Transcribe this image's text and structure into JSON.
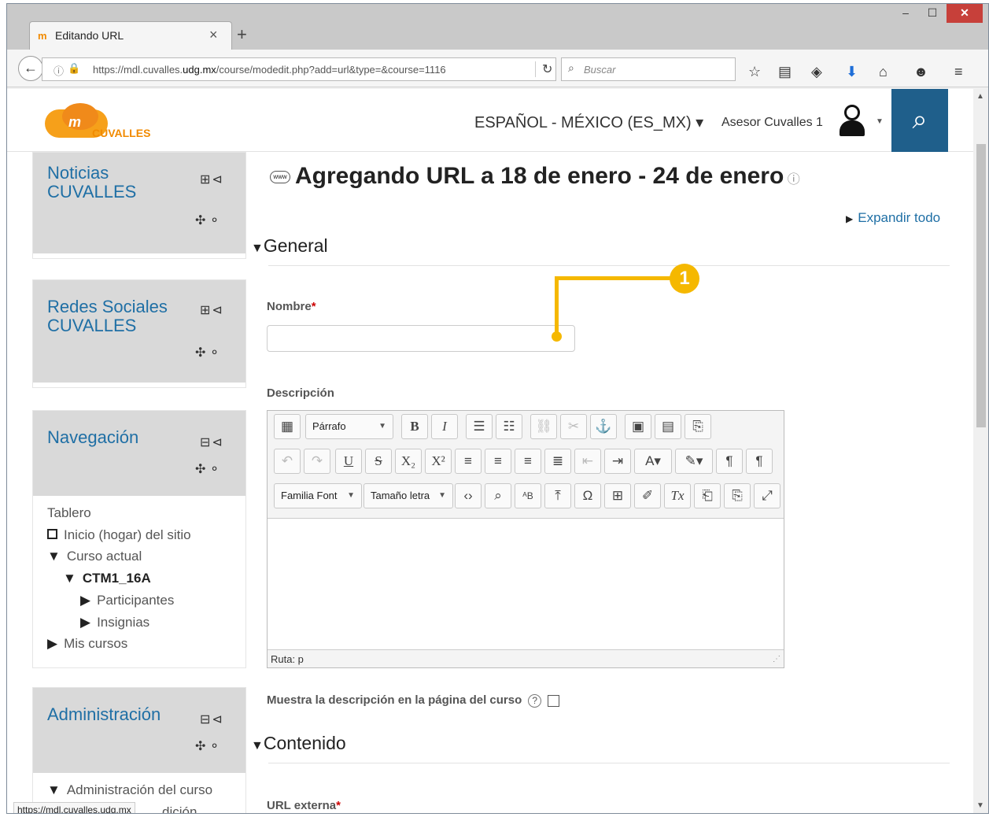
{
  "browser": {
    "tab_title": "Editando URL",
    "tab_favicon": "moodle-favicon",
    "new_tab": "+",
    "close_tab": "×",
    "url": "https://mdl.cuvalles.udg.mx/course/modedit.php?add=url&type=&course=1116",
    "url_prefix": "https://mdl.cuvalles.",
    "url_domain": "udg.mx",
    "url_suffix": "/course/modedit.php?add=url&type=&course=1116",
    "search_placeholder": "Buscar",
    "status_url": "https://mdl.cuvalles.udg.mx"
  },
  "header": {
    "logo_text": "m",
    "logo_sub": "CUVALLES",
    "language": "ESPAÑOL - MÉXICO (ES_MX) ▾",
    "user_name": "Asesor Cuvalles 1"
  },
  "blocks": {
    "noticias": {
      "title_line1": "Noticias",
      "title_line2": "CUVALLES"
    },
    "redes": {
      "title_line1": "Redes Sociales",
      "title_line2": "CUVALLES"
    },
    "navegacion": {
      "title": "Navegación",
      "items": [
        "Tablero",
        "Inicio (hogar) del sitio",
        "Curso actual",
        "CTM1_16A",
        "Participantes",
        "Insignias",
        "Mis cursos"
      ]
    },
    "administracion": {
      "title": "Administración",
      "items": [
        "Administración del curso",
        "dición"
      ]
    }
  },
  "main": {
    "page_title": "Agregando URL a 18 de enero - 24 de enero",
    "expand_all": "Expandir todo",
    "section_general": "General",
    "nombre_label": "Nombre",
    "required_mark": "*",
    "nombre_value": "",
    "descripcion_label": "Descripción",
    "editor": {
      "format_select": "Párrafo",
      "font_family": "Familia Font",
      "font_size": "Tamaño letra",
      "path": "Ruta: p"
    },
    "show_description_label": "Muestra la descripción en la página del curso",
    "section_contenido": "Contenido",
    "url_externa_label": "URL externa"
  },
  "callout": {
    "number": "1",
    "color": "#f5b800"
  },
  "colors": {
    "link": "#1f6fa5",
    "search_button": "#1f5f8b",
    "accent": "#f18a00"
  }
}
